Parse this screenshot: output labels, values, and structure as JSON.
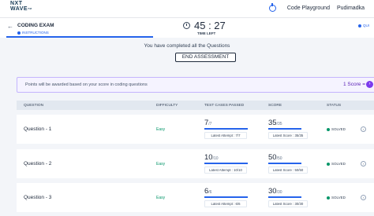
{
  "nav": {
    "logo_line1": "NXT",
    "logo_line2": "WAVE",
    "logo_tm": "TM",
    "code_playground": "Code Playground",
    "user_name": "Pudimadka"
  },
  "exam": {
    "title": "CODING EXAM",
    "instructions_tab": "INSTRUCTIONS",
    "timer": "45 : 27",
    "time_left_label": "TIME LEFT",
    "quiz_tab": "QUI"
  },
  "completion": {
    "message": "You have completed all the Questions",
    "end_button": "END ASSESSMENT"
  },
  "banner": {
    "text": "Points will be awarded based on your score in coding questions",
    "score_rule": "1 Score = 1"
  },
  "table": {
    "headers": {
      "question": "QUESTION",
      "difficulty": "DIFFICULTY",
      "test_cases": "TEST CASES PASSED",
      "score": "SCORE",
      "status": "STATUS"
    },
    "rows": [
      {
        "question": "Question - 1",
        "difficulty": "Easy",
        "tc_passed": "7",
        "tc_total": "/7",
        "tc_fraction": 1.0,
        "latest_attempt": "Latest Attempt : 7/7",
        "score": "35",
        "score_total": "/35",
        "score_fraction": 1.0,
        "latest_score": "Latest Score : 35/35",
        "status": "SOLVED"
      },
      {
        "question": "Question - 2",
        "difficulty": "Easy",
        "tc_passed": "10",
        "tc_total": "/10",
        "tc_fraction": 1.0,
        "latest_attempt": "Latest Attempt : 10/10",
        "score": "50",
        "score_total": "/50",
        "score_fraction": 1.0,
        "latest_score": "Latest Score : 50/50",
        "status": "SOLVED"
      },
      {
        "question": "Question - 3",
        "difficulty": "Easy",
        "tc_passed": "6",
        "tc_total": "/6",
        "tc_fraction": 1.0,
        "latest_attempt": "Latest Attempt : 6/6",
        "score": "30",
        "score_total": "/30",
        "score_fraction": 1.0,
        "latest_score": "Latest Score : 30/30",
        "status": "SOLVED"
      }
    ]
  },
  "colors": {
    "accent": "#2563eb",
    "success": "#059669",
    "banner_border": "#c4b5fd"
  }
}
